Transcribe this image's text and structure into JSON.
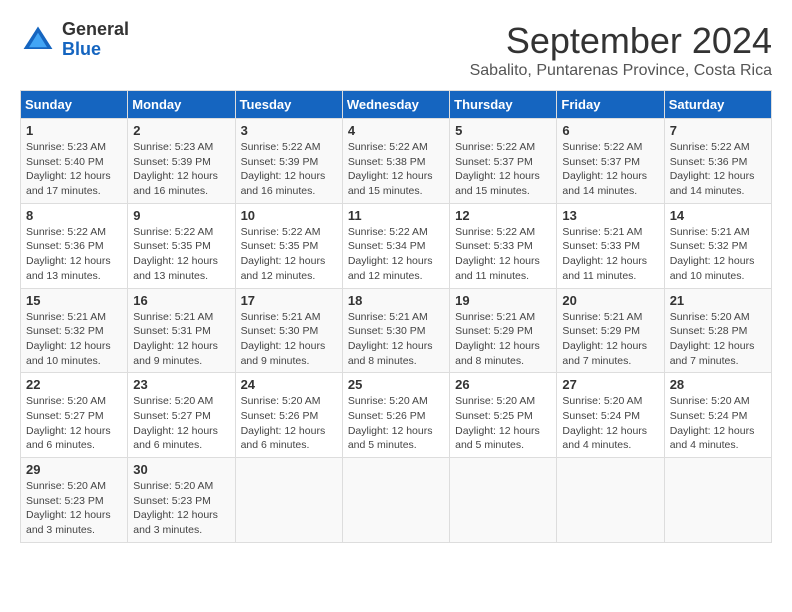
{
  "logo": {
    "line1": "General",
    "line2": "Blue"
  },
  "title": "September 2024",
  "subtitle": "Sabalito, Puntarenas Province, Costa Rica",
  "weekdays": [
    "Sunday",
    "Monday",
    "Tuesday",
    "Wednesday",
    "Thursday",
    "Friday",
    "Saturday"
  ],
  "weeks": [
    [
      {
        "day": 1,
        "sunrise": "5:23 AM",
        "sunset": "5:40 PM",
        "daylight": "12 hours and 17 minutes."
      },
      {
        "day": 2,
        "sunrise": "5:23 AM",
        "sunset": "5:39 PM",
        "daylight": "12 hours and 16 minutes."
      },
      {
        "day": 3,
        "sunrise": "5:22 AM",
        "sunset": "5:39 PM",
        "daylight": "12 hours and 16 minutes."
      },
      {
        "day": 4,
        "sunrise": "5:22 AM",
        "sunset": "5:38 PM",
        "daylight": "12 hours and 15 minutes."
      },
      {
        "day": 5,
        "sunrise": "5:22 AM",
        "sunset": "5:37 PM",
        "daylight": "12 hours and 15 minutes."
      },
      {
        "day": 6,
        "sunrise": "5:22 AM",
        "sunset": "5:37 PM",
        "daylight": "12 hours and 14 minutes."
      },
      {
        "day": 7,
        "sunrise": "5:22 AM",
        "sunset": "5:36 PM",
        "daylight": "12 hours and 14 minutes."
      }
    ],
    [
      {
        "day": 8,
        "sunrise": "5:22 AM",
        "sunset": "5:36 PM",
        "daylight": "12 hours and 13 minutes."
      },
      {
        "day": 9,
        "sunrise": "5:22 AM",
        "sunset": "5:35 PM",
        "daylight": "12 hours and 13 minutes."
      },
      {
        "day": 10,
        "sunrise": "5:22 AM",
        "sunset": "5:35 PM",
        "daylight": "12 hours and 12 minutes."
      },
      {
        "day": 11,
        "sunrise": "5:22 AM",
        "sunset": "5:34 PM",
        "daylight": "12 hours and 12 minutes."
      },
      {
        "day": 12,
        "sunrise": "5:22 AM",
        "sunset": "5:33 PM",
        "daylight": "12 hours and 11 minutes."
      },
      {
        "day": 13,
        "sunrise": "5:21 AM",
        "sunset": "5:33 PM",
        "daylight": "12 hours and 11 minutes."
      },
      {
        "day": 14,
        "sunrise": "5:21 AM",
        "sunset": "5:32 PM",
        "daylight": "12 hours and 10 minutes."
      }
    ],
    [
      {
        "day": 15,
        "sunrise": "5:21 AM",
        "sunset": "5:32 PM",
        "daylight": "12 hours and 10 minutes."
      },
      {
        "day": 16,
        "sunrise": "5:21 AM",
        "sunset": "5:31 PM",
        "daylight": "12 hours and 9 minutes."
      },
      {
        "day": 17,
        "sunrise": "5:21 AM",
        "sunset": "5:30 PM",
        "daylight": "12 hours and 9 minutes."
      },
      {
        "day": 18,
        "sunrise": "5:21 AM",
        "sunset": "5:30 PM",
        "daylight": "12 hours and 8 minutes."
      },
      {
        "day": 19,
        "sunrise": "5:21 AM",
        "sunset": "5:29 PM",
        "daylight": "12 hours and 8 minutes."
      },
      {
        "day": 20,
        "sunrise": "5:21 AM",
        "sunset": "5:29 PM",
        "daylight": "12 hours and 7 minutes."
      },
      {
        "day": 21,
        "sunrise": "5:20 AM",
        "sunset": "5:28 PM",
        "daylight": "12 hours and 7 minutes."
      }
    ],
    [
      {
        "day": 22,
        "sunrise": "5:20 AM",
        "sunset": "5:27 PM",
        "daylight": "12 hours and 6 minutes."
      },
      {
        "day": 23,
        "sunrise": "5:20 AM",
        "sunset": "5:27 PM",
        "daylight": "12 hours and 6 minutes."
      },
      {
        "day": 24,
        "sunrise": "5:20 AM",
        "sunset": "5:26 PM",
        "daylight": "12 hours and 6 minutes."
      },
      {
        "day": 25,
        "sunrise": "5:20 AM",
        "sunset": "5:26 PM",
        "daylight": "12 hours and 5 minutes."
      },
      {
        "day": 26,
        "sunrise": "5:20 AM",
        "sunset": "5:25 PM",
        "daylight": "12 hours and 5 minutes."
      },
      {
        "day": 27,
        "sunrise": "5:20 AM",
        "sunset": "5:24 PM",
        "daylight": "12 hours and 4 minutes."
      },
      {
        "day": 28,
        "sunrise": "5:20 AM",
        "sunset": "5:24 PM",
        "daylight": "12 hours and 4 minutes."
      }
    ],
    [
      {
        "day": 29,
        "sunrise": "5:20 AM",
        "sunset": "5:23 PM",
        "daylight": "12 hours and 3 minutes."
      },
      {
        "day": 30,
        "sunrise": "5:20 AM",
        "sunset": "5:23 PM",
        "daylight": "12 hours and 3 minutes."
      },
      null,
      null,
      null,
      null,
      null
    ]
  ]
}
